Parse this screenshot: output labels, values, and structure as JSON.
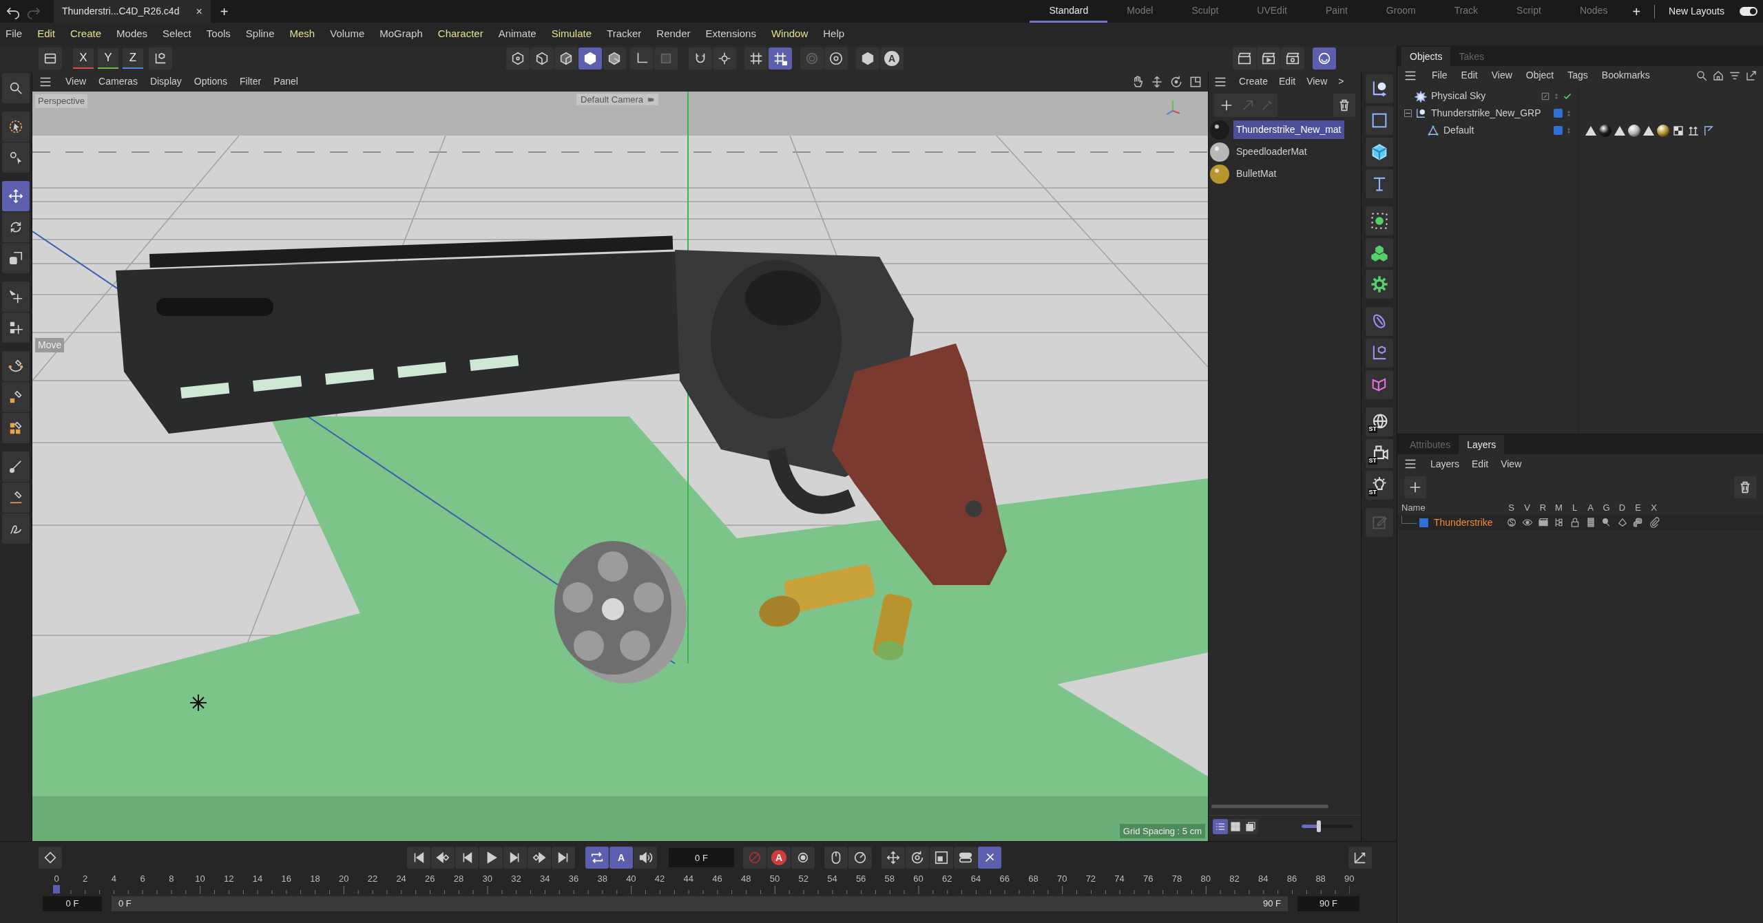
{
  "title_bar": {
    "document_tab": "Thunderstri...C4D_R26.c4d",
    "close": "×",
    "new_tab": "+",
    "layouts": [
      {
        "label": "Standard",
        "selected": true
      },
      {
        "label": "Model",
        "selected": false
      },
      {
        "label": "Sculpt",
        "selected": false
      },
      {
        "label": "UVEdit",
        "selected": false
      },
      {
        "label": "Paint",
        "selected": false
      },
      {
        "label": "Groom",
        "selected": false
      },
      {
        "label": "Track",
        "selected": false
      },
      {
        "label": "Script",
        "selected": false
      },
      {
        "label": "Nodes",
        "selected": false
      }
    ],
    "add_layout": "+",
    "new_layouts": "New Layouts",
    "new_layouts_toggle": {
      "on": true
    }
  },
  "menu_bar": [
    {
      "label": "File",
      "accent": false
    },
    {
      "label": "Edit",
      "accent": true
    },
    {
      "label": "Create",
      "accent": true
    },
    {
      "label": "Modes",
      "accent": false
    },
    {
      "label": "Select",
      "accent": false
    },
    {
      "label": "Tools",
      "accent": false
    },
    {
      "label": "Spline",
      "accent": false
    },
    {
      "label": "Mesh",
      "accent": true
    },
    {
      "label": "Volume",
      "accent": false
    },
    {
      "label": "MoGraph",
      "accent": false
    },
    {
      "label": "Character",
      "accent": true
    },
    {
      "label": "Animate",
      "accent": false
    },
    {
      "label": "Simulate",
      "accent": true
    },
    {
      "label": "Tracker",
      "accent": false
    },
    {
      "label": "Render",
      "accent": false
    },
    {
      "label": "Extensions",
      "accent": false
    },
    {
      "label": "Window",
      "accent": true
    },
    {
      "label": "Help",
      "accent": false
    }
  ],
  "toolbar": {
    "axes": [
      {
        "label": "X",
        "color": "#e04848"
      },
      {
        "label": "Y",
        "color": "#6cc04a"
      },
      {
        "label": "Z",
        "color": "#4a8ce0"
      }
    ],
    "tools": [
      {
        "selected": false
      },
      {
        "selected": false
      },
      {
        "selected": false
      },
      {
        "selected": false
      },
      {
        "selected": false
      },
      {
        "selected": true
      },
      {
        "selected": false
      },
      {
        "selected": false
      },
      {
        "selected": false
      },
      {
        "selected": false
      },
      {
        "selected": false
      },
      {
        "selected": false
      },
      {
        "selected": true
      },
      {
        "selected": false
      },
      {
        "selected": false
      },
      {
        "selected": false
      },
      {
        "selected": false,
        "glyph": "A"
      },
      {
        "selected": false
      },
      {
        "selected": false
      },
      {
        "selected": false
      },
      {
        "selected": true
      }
    ]
  },
  "left_toolbar": [
    {
      "selected": false
    },
    {
      "selected": false
    },
    {
      "selected": false
    },
    {
      "selected": true
    },
    {
      "selected": false
    },
    {
      "selected": false
    },
    {
      "selected": false
    },
    {
      "selected": false
    },
    {
      "selected": false
    },
    {
      "selected": false
    },
    {
      "selected": false
    },
    {
      "selected": false
    },
    {
      "selected": false
    },
    {
      "selected": false
    }
  ],
  "viewport": {
    "menu": [
      "View",
      "Cameras",
      "Display",
      "Options",
      "Filter",
      "Panel"
    ],
    "camera": "Perspective",
    "active_camera": "Default Camera",
    "tool_hint": "Move",
    "grid_spacing": "Grid Spacing : 5 cm"
  },
  "material_manager": {
    "menu": [
      "Create",
      "Edit",
      "View",
      ">"
    ],
    "materials": [
      {
        "name": "Thunderstrike_New_mat",
        "selected": true,
        "color": "#1c1c1c"
      },
      {
        "name": "SpeedloaderMat",
        "selected": false,
        "color": "#b8b8b8"
      },
      {
        "name": "BulletMat",
        "selected": false,
        "color": "#b8962e"
      }
    ],
    "view_modes": [
      {
        "selected": true
      },
      {
        "selected": false
      },
      {
        "selected": false
      }
    ],
    "thumbnail_size": {
      "level": 0.34
    }
  },
  "palette": {
    "badges": [
      "ST",
      "ST",
      "ST"
    ]
  },
  "object_manager": {
    "tabs": [
      {
        "label": "Objects",
        "selected": true
      },
      {
        "label": "Takes",
        "selected": false
      }
    ],
    "menu": [
      "File",
      "Edit",
      "View",
      "Object",
      "Tags",
      "Bookmarks"
    ],
    "objects": [
      {
        "name": "Physical Sky",
        "kind": "sky"
      },
      {
        "name": "Thunderstrike_New_GRP",
        "kind": "null",
        "color": "#2f6fd6",
        "expanded": true,
        "children": [
          {
            "name": "Default",
            "kind": "polygon",
            "color": "#2f6fd6"
          }
        ]
      }
    ]
  },
  "layer_manager": {
    "tabs": [
      {
        "label": "Attributes",
        "selected": false
      },
      {
        "label": "Layers",
        "selected": true
      }
    ],
    "menu": [
      "Layers",
      "Edit",
      "View"
    ],
    "columns": [
      "Name",
      "S",
      "V",
      "R",
      "M",
      "L",
      "A",
      "G",
      "D",
      "E",
      "X"
    ],
    "layers": [
      {
        "name": "Thunderstrike",
        "color": "#2f6fd6",
        "selected": true
      }
    ]
  },
  "timeline": {
    "frame": "0 F",
    "controls": [
      {
        "selected": false
      },
      {
        "selected": false
      },
      {
        "selected": false
      },
      {
        "selected": false
      },
      {
        "selected": false
      },
      {
        "selected": false
      },
      {
        "selected": false
      },
      {
        "selected": false
      },
      {
        "selected": true
      },
      {
        "selected": true,
        "glyph": "A"
      },
      {
        "selected": false
      },
      {
        "selected": false
      },
      {
        "selected": false,
        "glyph": "A"
      },
      {
        "selected": false
      },
      {
        "selected": false
      },
      {
        "selected": false
      },
      {
        "selected": false
      },
      {
        "selected": false
      },
      {
        "selected": false
      },
      {
        "selected": false
      },
      {
        "selected": true
      },
      {
        "selected": false
      }
    ],
    "ticks": [
      "0",
      "2",
      "4",
      "6",
      "8",
      "10",
      "12",
      "14",
      "16",
      "18",
      "20",
      "22",
      "24",
      "26",
      "28",
      "30",
      "32",
      "34",
      "36",
      "38",
      "40",
      "42",
      "44",
      "46",
      "48",
      "50",
      "52",
      "54",
      "56",
      "58",
      "60",
      "62",
      "64",
      "66",
      "68",
      "70",
      "72",
      "74",
      "76",
      "78",
      "80",
      "82",
      "84",
      "86",
      "88",
      "90"
    ],
    "start": "0 F",
    "range_start": "0 F",
    "range_end": "90 F",
    "end": "90 F"
  }
}
